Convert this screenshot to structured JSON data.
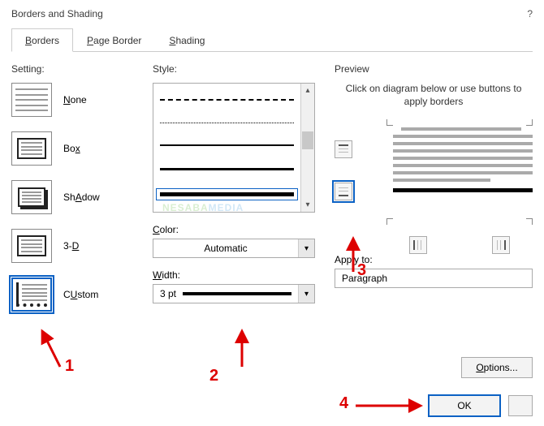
{
  "window": {
    "title": "Borders and Shading",
    "help": "?"
  },
  "tabs": [
    {
      "label": "Borders",
      "accel": "B",
      "active": true
    },
    {
      "label": "Page Border",
      "accel": "P",
      "active": false
    },
    {
      "label": "Shading",
      "accel": "S",
      "active": false
    }
  ],
  "setting": {
    "label": "Setting:",
    "items": [
      {
        "key": "none",
        "label": "None",
        "accel": "N"
      },
      {
        "key": "box",
        "label": "Box",
        "accel": "x"
      },
      {
        "key": "shadow",
        "label": "Shadow",
        "accel": "A"
      },
      {
        "key": "3d",
        "label": "3-D",
        "accel": "D"
      },
      {
        "key": "custom",
        "label": "Custom",
        "accel": "U",
        "selected": true
      }
    ]
  },
  "style": {
    "label": "Style:"
  },
  "color": {
    "label": "Color:",
    "value": "Automatic"
  },
  "width": {
    "label": "Width:",
    "value": "3 pt"
  },
  "preview": {
    "label": "Preview",
    "hint": "Click on diagram below or use buttons to apply borders"
  },
  "apply": {
    "label": "Apply to:",
    "value": "Paragraph"
  },
  "buttons": {
    "options": "Options...",
    "ok": "OK"
  },
  "ann": {
    "n1": "1",
    "n2": "2",
    "n3": "3",
    "n4": "4"
  },
  "watermark": "NESABAMEDIA"
}
